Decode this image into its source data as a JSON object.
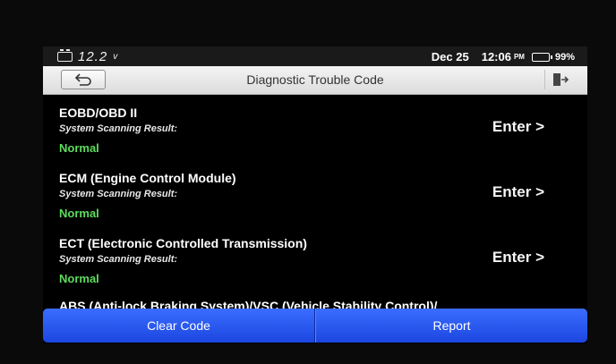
{
  "status": {
    "voltage": "12.2",
    "voltage_unit": "v",
    "date": "Dec 25",
    "time": "12:06",
    "ampm": "PM",
    "battery": "99%"
  },
  "header": {
    "title": "Diagnostic Trouble Code"
  },
  "modules": [
    {
      "name": "EOBD/OBD II",
      "scan_label": "System Scanning Result:",
      "result": "Normal",
      "enter": "Enter >"
    },
    {
      "name": "ECM (Engine Control Module)",
      "scan_label": "System Scanning Result:",
      "result": "Normal",
      "enter": "Enter >"
    },
    {
      "name": "ECT (Electronic Controlled Transmission)",
      "scan_label": "System Scanning Result:",
      "result": "Normal",
      "enter": "Enter >"
    }
  ],
  "partial_module": {
    "name": "ABS (Anti-lock Braking System)/VSC (Vehicle Stability Control)/"
  },
  "toolbar": {
    "clear_code": "Clear Code",
    "report": "Report"
  },
  "colors": {
    "normal_green": "#5ddc5d",
    "toolbar_blue": "#1c46e0"
  },
  "icons": {
    "back": "back-arrow-icon",
    "exit": "exit-icon",
    "car_battery": "car-battery-icon",
    "phone_battery": "battery-icon"
  }
}
